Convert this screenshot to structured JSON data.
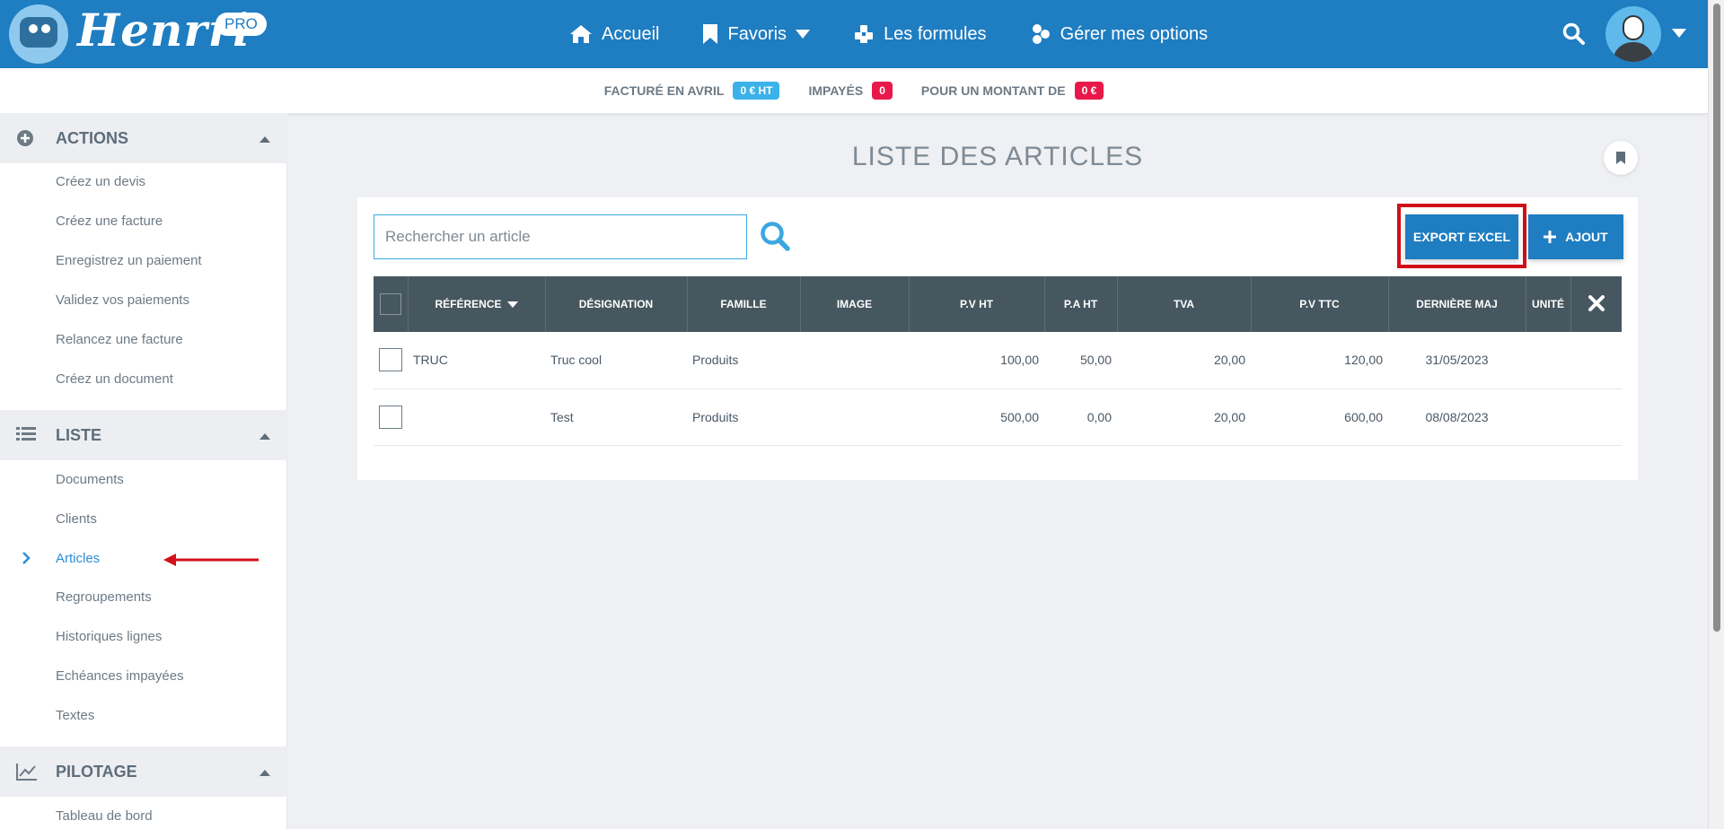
{
  "header": {
    "brand": "Henrri",
    "pro_badge": "PRO",
    "nav": [
      {
        "label": "Accueil",
        "icon": "home-icon"
      },
      {
        "label": "Favoris",
        "icon": "bookmark-icon"
      },
      {
        "label": "Les formules",
        "icon": "packages-icon"
      },
      {
        "label": "Gérer mes options",
        "icon": "options-icon"
      }
    ]
  },
  "stats": {
    "billed_label": "FACTURÉ EN AVRIL",
    "billed_value": "0 € HT",
    "unpaid_label": "IMPAYÉS",
    "unpaid_value": "0",
    "amount_label": "POUR UN MONTANT DE",
    "amount_value": "0 €"
  },
  "sidebar": {
    "actions": {
      "title": "ACTIONS",
      "items": [
        "Créez un devis",
        "Créez une facture",
        "Enregistrez un paiement",
        "Validez vos paiements",
        "Relancez une facture",
        "Créez un document"
      ]
    },
    "liste": {
      "title": "LISTE",
      "items": [
        "Documents",
        "Clients",
        "Articles",
        "Regroupements",
        "Historiques lignes",
        "Echéances impayées",
        "Textes"
      ],
      "active": "Articles"
    },
    "pilotage": {
      "title": "PILOTAGE",
      "items": [
        "Tableau de bord"
      ]
    }
  },
  "main": {
    "title": "LISTE DES ARTICLES",
    "search_placeholder": "Rechercher un article",
    "export_label": "EXPORT EXCEL",
    "add_label": "AJOUT",
    "columns": [
      "RÉFÉRENCE",
      "DÉSIGNATION",
      "FAMILLE",
      "IMAGE",
      "P.V HT",
      "P.A HT",
      "TVA",
      "P.V TTC",
      "DERNIÈRE MAJ",
      "UNITÉ"
    ],
    "rows": [
      {
        "reference": "TRUC",
        "designation": "Truc cool",
        "famille": "Produits",
        "image": "",
        "pv_ht": "100,00",
        "pa_ht": "50,00",
        "tva": "20,00",
        "pv_ttc": "120,00",
        "maj": "31/05/2023",
        "unite": ""
      },
      {
        "reference": "",
        "designation": "Test",
        "famille": "Produits",
        "image": "",
        "pv_ht": "500,00",
        "pa_ht": "0,00",
        "tva": "20,00",
        "pv_ttc": "600,00",
        "maj": "08/08/2023",
        "unite": ""
      }
    ]
  },
  "colors": {
    "primary": "#1f7dc1",
    "table_header": "#46575f",
    "badge_blue": "#3bb2ea",
    "badge_red": "#e8194a",
    "highlight_red": "#d0101a"
  }
}
